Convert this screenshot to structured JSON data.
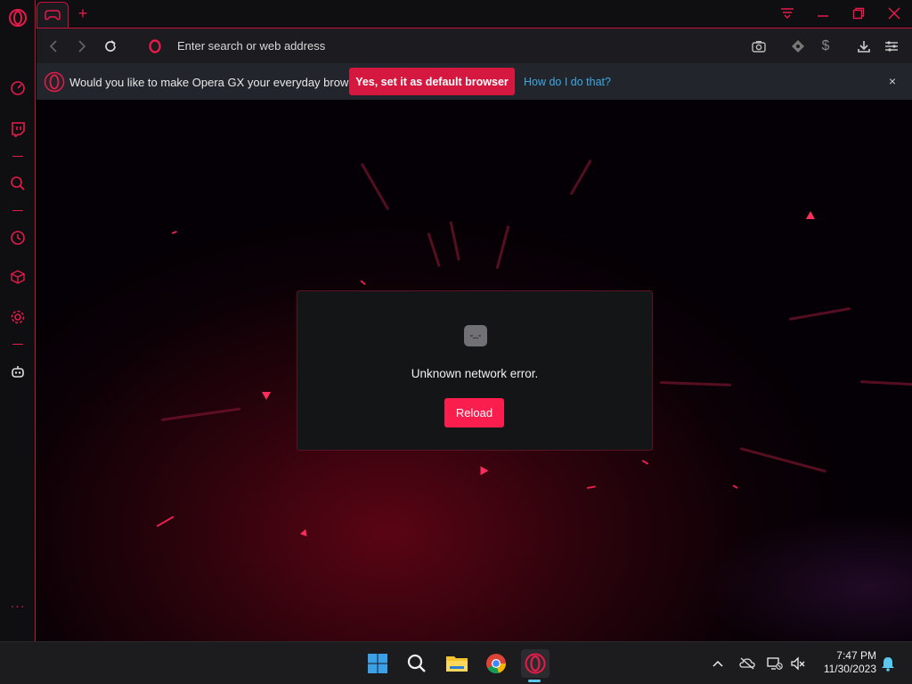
{
  "browser": {
    "address_placeholder": "Enter search or web address"
  },
  "infobar": {
    "message": "Would you like to make Opera GX your everyday browser?",
    "primary_button": "Yes, set it as default browser",
    "help_link": "How do I do that?",
    "close": "×"
  },
  "error_dialog": {
    "message": "Unknown network error.",
    "reload_button": "Reload"
  },
  "tabs": {
    "new_tab": "+"
  },
  "sidebar": {
    "more": "···"
  },
  "taskbar": {
    "time": "7:47 PM",
    "date": "11/30/2023"
  },
  "colors": {
    "accent": "#e51b4a",
    "infobar_button": "#d5183f",
    "reload_button": "#fa1e4e",
    "link": "#3da9e3"
  },
  "icons": {
    "sidebar": [
      "opera-logo-icon",
      "speedometer-icon",
      "twitch-icon",
      "search-icon",
      "history-clock-icon",
      "cube-icon",
      "settings-gear-icon",
      "robot-icon",
      "more-icon"
    ],
    "toolbar": [
      "camera-snapshot-icon",
      "vpn-icon",
      "wallet-icon",
      "download-icon",
      "easy-setup-icon"
    ],
    "taskbar": [
      "windows-start-icon",
      "search-icon",
      "file-explorer-icon",
      "chrome-icon",
      "opera-gx-icon"
    ]
  }
}
